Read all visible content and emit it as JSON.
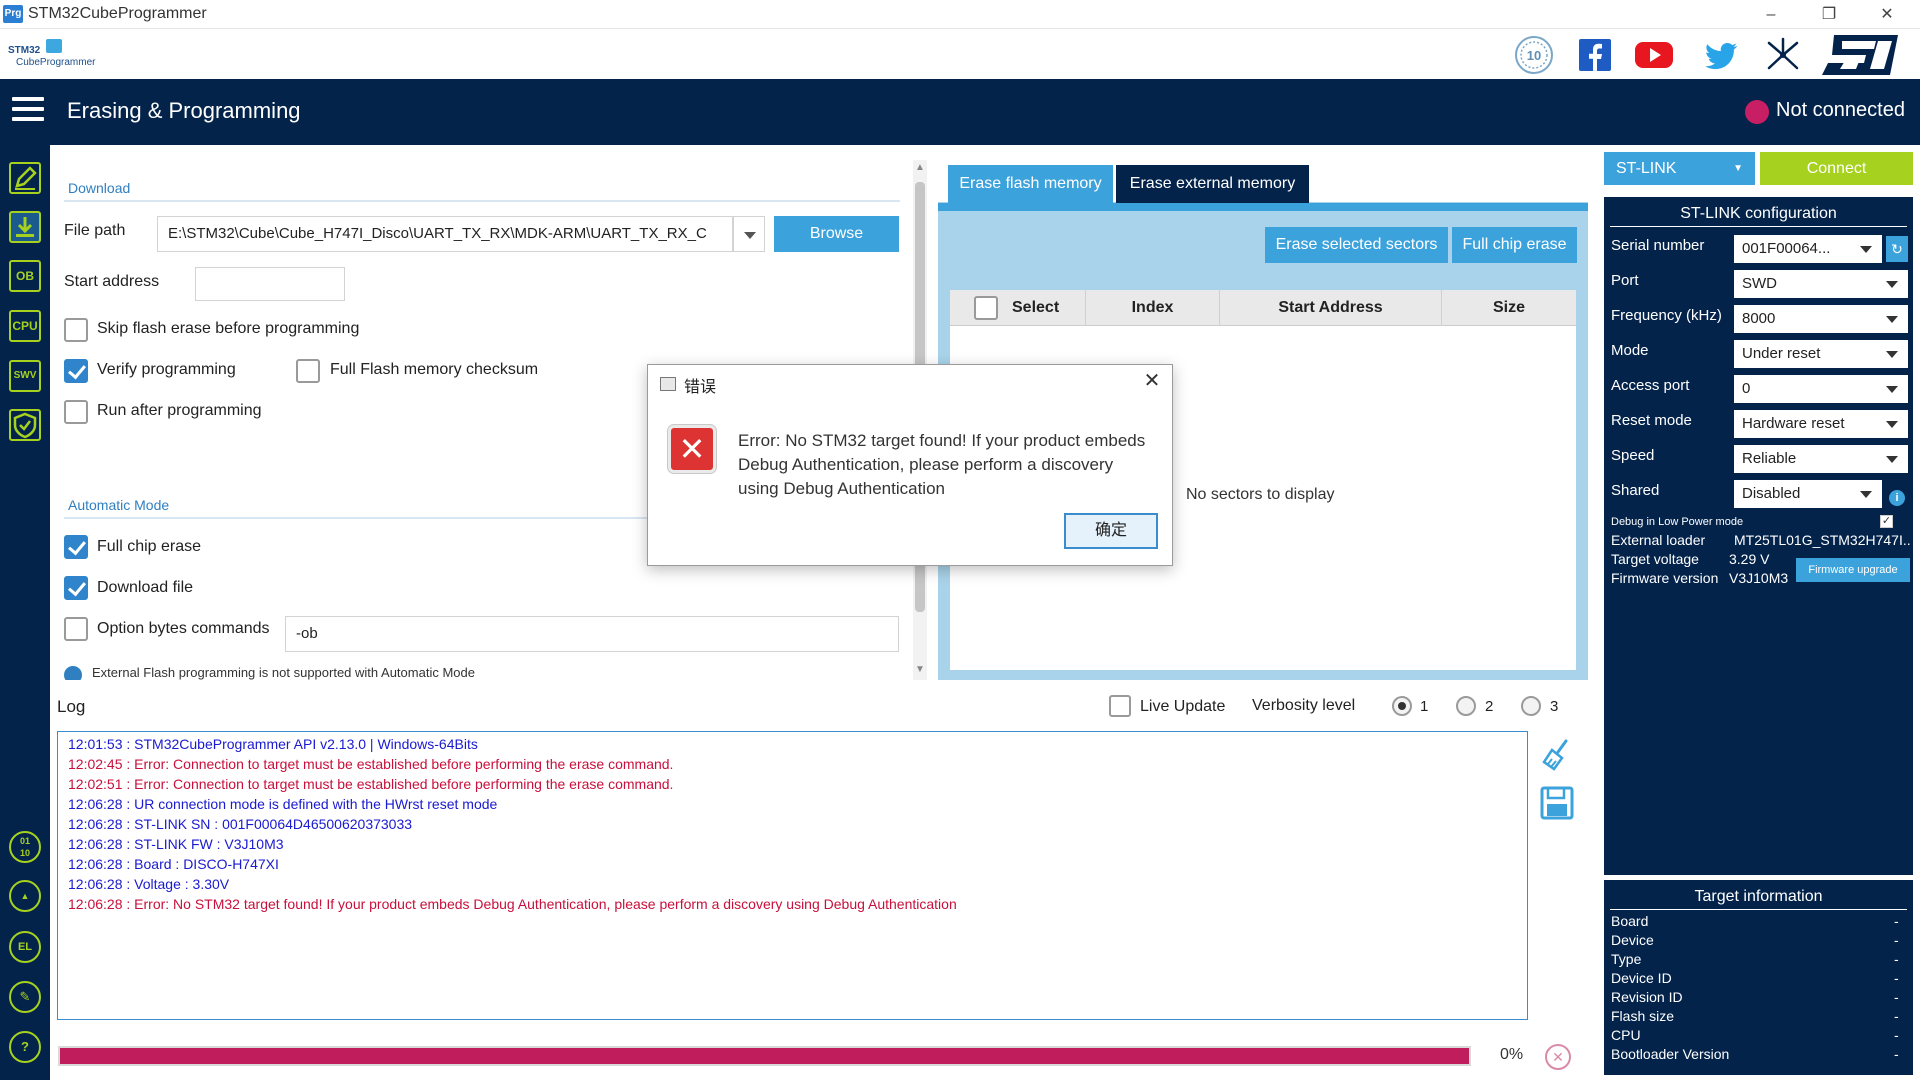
{
  "window": {
    "title": "STM32CubeProgrammer",
    "app_icon": "Prg",
    "minimize": "–",
    "maximize": "❐",
    "close": "✕"
  },
  "logo": {
    "line1": "STM32",
    "line2": "CubeProgrammer"
  },
  "header": {
    "title": "Erasing & Programming",
    "connection_status": "Not connected",
    "status_color": "#c81e64"
  },
  "nav": {
    "items": [
      "",
      "",
      "OB",
      "CPU",
      "SWV",
      ""
    ],
    "bottom_items": [
      "",
      "",
      "",
      "",
      "?"
    ]
  },
  "download": {
    "section_title": "Download",
    "file_path_label": "File path",
    "file_path_value": "E:\\STM32\\Cube\\Cube_H747I_Disco\\UART_TX_RX\\MDK-ARM\\UART_TX_RX_C",
    "browse_label": "Browse",
    "start_address_label": "Start address",
    "start_address_value": "",
    "skip_erase_label": "Skip flash erase before programming",
    "verify_label": "Verify programming",
    "checksum_label": "Full Flash memory checksum",
    "run_after_label": "Run after programming"
  },
  "automatic": {
    "section_title": "Automatic Mode",
    "full_chip_erase_label": "Full chip erase",
    "download_file_label": "Download file",
    "option_bytes_label": "Option bytes commands",
    "option_bytes_value": "-ob",
    "note": "External Flash programming is not supported with Automatic Mode"
  },
  "erase": {
    "tab_flash": "Erase flash memory",
    "tab_external": "Erase external memory",
    "erase_selected_label": "Erase selected sectors",
    "full_chip_erase_label": "Full chip erase",
    "columns": [
      "Select",
      "Index",
      "Start Address",
      "Size"
    ],
    "empty_text": "No sectors to display"
  },
  "interface": {
    "selected": "ST-LINK",
    "connect_label": "Connect",
    "config_title": "ST-LINK configuration",
    "fields": [
      {
        "label": "Serial number",
        "value": "001F00064..."
      },
      {
        "label": "Port",
        "value": "SWD"
      },
      {
        "label": "Frequency (kHz)",
        "value": "8000"
      },
      {
        "label": "Mode",
        "value": "Under reset"
      },
      {
        "label": "Access port",
        "value": "0"
      },
      {
        "label": "Reset mode",
        "value": "Hardware reset"
      },
      {
        "label": "Speed",
        "value": "Reliable"
      },
      {
        "label": "Shared",
        "value": "Disabled"
      }
    ],
    "debug_low_power_label": "Debug in Low Power mode",
    "external_loader_label": "External loader",
    "external_loader_value": "MT25TL01G_STM32H747I...",
    "target_voltage_label": "Target voltage",
    "target_voltage_value": "3.29 V",
    "firmware_version_label": "Firmware version",
    "firmware_version_value": "V3J10M3",
    "firmware_upgrade_label": "Firmware upgrade"
  },
  "target": {
    "title": "Target information",
    "rows": [
      {
        "label": "Board",
        "value": "-"
      },
      {
        "label": "Device",
        "value": "-"
      },
      {
        "label": "Type",
        "value": "-"
      },
      {
        "label": "Device ID",
        "value": "-"
      },
      {
        "label": "Revision ID",
        "value": "-"
      },
      {
        "label": "Flash size",
        "value": "-"
      },
      {
        "label": "CPU",
        "value": "-"
      },
      {
        "label": "Bootloader Version",
        "value": "-"
      }
    ]
  },
  "log": {
    "title": "Log",
    "live_update_label": "Live Update",
    "verbosity_label": "Verbosity level",
    "verbosity_options": [
      "1",
      "2",
      "3"
    ],
    "verbosity_selected": "1",
    "lines": [
      {
        "text": "12:01:53 : STM32CubeProgrammer API v2.13.0 | Windows-64Bits",
        "color": "#1a1ad0"
      },
      {
        "text": "12:02:45 : Error: Connection to target must be established before performing the erase command.",
        "color": "#c8103c"
      },
      {
        "text": "12:02:51 : Error: Connection to target must be established before performing the erase command.",
        "color": "#c8103c"
      },
      {
        "text": "12:06:28 : UR connection mode is defined with the HWrst reset mode",
        "color": "#1a1ad0"
      },
      {
        "text": "12:06:28 : ST-LINK SN  : 001F00064D46500620373033",
        "color": "#1a1ad0"
      },
      {
        "text": "12:06:28 : ST-LINK FW  : V3J10M3",
        "color": "#1a1ad0"
      },
      {
        "text": "12:06:28 : Board       : DISCO-H747XI",
        "color": "#1a1ad0"
      },
      {
        "text": "12:06:28 : Voltage     : 3.30V",
        "color": "#1a1ad0"
      },
      {
        "text": "12:06:28 : Error: No STM32 target found! If your product embeds Debug Authentication, please perform a discovery using Debug Authentication",
        "color": "#c8103c"
      }
    ],
    "progress_percent": 100,
    "progress_text": "0%",
    "progress_color": "#bf1d5c"
  },
  "dialog": {
    "title": "错误",
    "message": "Error: No STM32 target found! If your product embeds Debug Authentication, please perform a discovery using Debug Authentication",
    "ok_label": "确定",
    "close_label": "✕",
    "error_glyph": "✕"
  }
}
